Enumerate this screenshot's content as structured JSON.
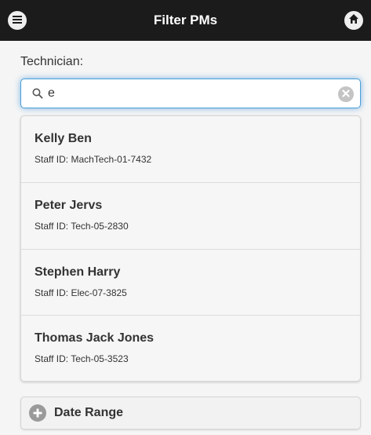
{
  "header": {
    "title": "Filter PMs",
    "menu_icon": "hamburger-menu-icon",
    "home_icon": "home-icon"
  },
  "technician": {
    "label": "Technician:",
    "search": {
      "value": "e",
      "icon": "search-icon",
      "clear_icon": "clear-x-icon"
    },
    "results": [
      {
        "name": "Kelly Ben",
        "staff_id": "Staff ID: MachTech-01-7432"
      },
      {
        "name": "Peter Jervs",
        "staff_id": "Staff ID: Tech-05-2830"
      },
      {
        "name": "Stephen Harry",
        "staff_id": "Staff ID: Elec-07-3825"
      },
      {
        "name": "Thomas Jack Jones",
        "staff_id": "Staff ID: Tech-05-3523"
      }
    ]
  },
  "date_range": {
    "label": "Date Range",
    "icon": "plus-circle-icon"
  },
  "colors": {
    "header_bg": "#1b1b1b",
    "focus_glow": "#4a9fd9",
    "page_bg": "#f5f5f5"
  }
}
